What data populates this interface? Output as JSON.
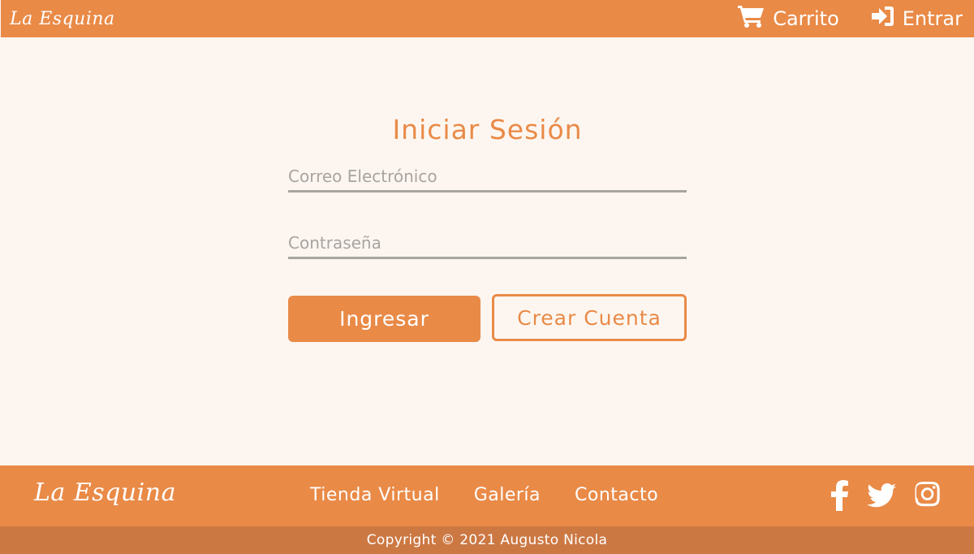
{
  "brand": "La Esquina",
  "header": {
    "nav": [
      {
        "label": "Carrito",
        "icon": "cart-icon"
      },
      {
        "label": "Entrar",
        "icon": "sign-in-icon"
      }
    ]
  },
  "login": {
    "title": "Iniciar Sesión",
    "email_placeholder": "Correo Electrónico",
    "password_placeholder": "Contraseña",
    "submit_label": "Ingresar",
    "create_label": "Crear Cuenta"
  },
  "footer": {
    "links": [
      "Tienda Virtual",
      "Galería",
      "Contacto"
    ],
    "social": [
      "facebook-icon",
      "twitter-icon",
      "instagram-icon"
    ],
    "copyright": "Copyright © 2021 Augusto Nicola"
  },
  "colors": {
    "accent": "#e98a47",
    "accent_dark": "#cc7843",
    "background": "#fdf6f0",
    "muted": "#a8a4a1"
  }
}
